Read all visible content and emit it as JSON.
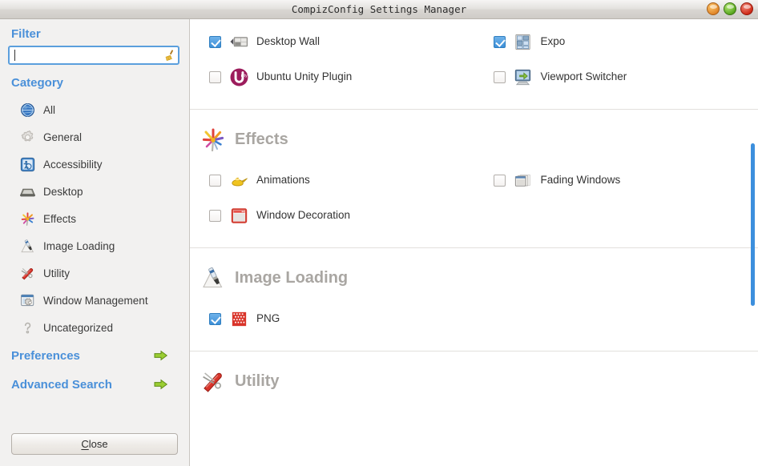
{
  "window": {
    "title": "CompizConfig Settings Manager",
    "buttons": [
      {
        "name": "minimize",
        "color": "#e1872a"
      },
      {
        "name": "maximize",
        "color": "#5aa81f"
      },
      {
        "name": "close",
        "color": "#d02b18"
      }
    ]
  },
  "sidebar": {
    "filter_heading": "Filter",
    "filter": {
      "value": "",
      "placeholder": "",
      "clear_icon": "broom-icon"
    },
    "category_heading": "Category",
    "items": [
      {
        "label": "All",
        "icon": "globe-icon"
      },
      {
        "label": "General",
        "icon": "gear-icon"
      },
      {
        "label": "Accessibility",
        "icon": "accessibility-icon"
      },
      {
        "label": "Desktop",
        "icon": "desktop-icon"
      },
      {
        "label": "Effects",
        "icon": "fireworks-icon"
      },
      {
        "label": "Image Loading",
        "icon": "paintbrush-icon"
      },
      {
        "label": "Utility",
        "icon": "swiss-knife-icon"
      },
      {
        "label": "Window Management",
        "icon": "window-gear-icon"
      },
      {
        "label": "Uncategorized",
        "icon": "question-mark-icon"
      }
    ],
    "links": [
      {
        "label": "Preferences",
        "icon": "green-arrow-icon"
      },
      {
        "label": "Advanced Search",
        "icon": "green-arrow-icon"
      }
    ],
    "close_button": {
      "prefix": "",
      "mnemonic": "C",
      "rest": "lose"
    }
  },
  "main": {
    "accent_color": "#4a90d9",
    "scrollbar_color": "#3c8fdd",
    "groups": [
      {
        "title": "",
        "icon": "",
        "show_header": false,
        "plugins": [
          {
            "label": "Desktop Wall",
            "checked": true,
            "icon": "desktop-wall-icon"
          },
          {
            "label": "Expo",
            "checked": true,
            "icon": "expo-icon"
          },
          {
            "label": "Ubuntu Unity Plugin",
            "checked": false,
            "icon": "ubuntu-unity-icon"
          },
          {
            "label": "Viewport Switcher",
            "checked": false,
            "icon": "viewport-switcher-icon"
          }
        ]
      },
      {
        "title": "Effects",
        "icon": "fireworks-icon",
        "show_header": true,
        "plugins": [
          {
            "label": "Animations",
            "checked": false,
            "icon": "genie-lamp-icon"
          },
          {
            "label": "Fading Windows",
            "checked": false,
            "icon": "fading-windows-icon"
          },
          {
            "label": "Window Decoration",
            "checked": false,
            "icon": "window-decoration-icon"
          }
        ]
      },
      {
        "title": "Image Loading",
        "icon": "paintbrush-icon",
        "show_header": true,
        "plugins": [
          {
            "label": "PNG",
            "checked": true,
            "icon": "png-icon"
          }
        ]
      },
      {
        "title": "Utility",
        "icon": "swiss-knife-icon",
        "show_header": true,
        "plugins": []
      }
    ]
  }
}
